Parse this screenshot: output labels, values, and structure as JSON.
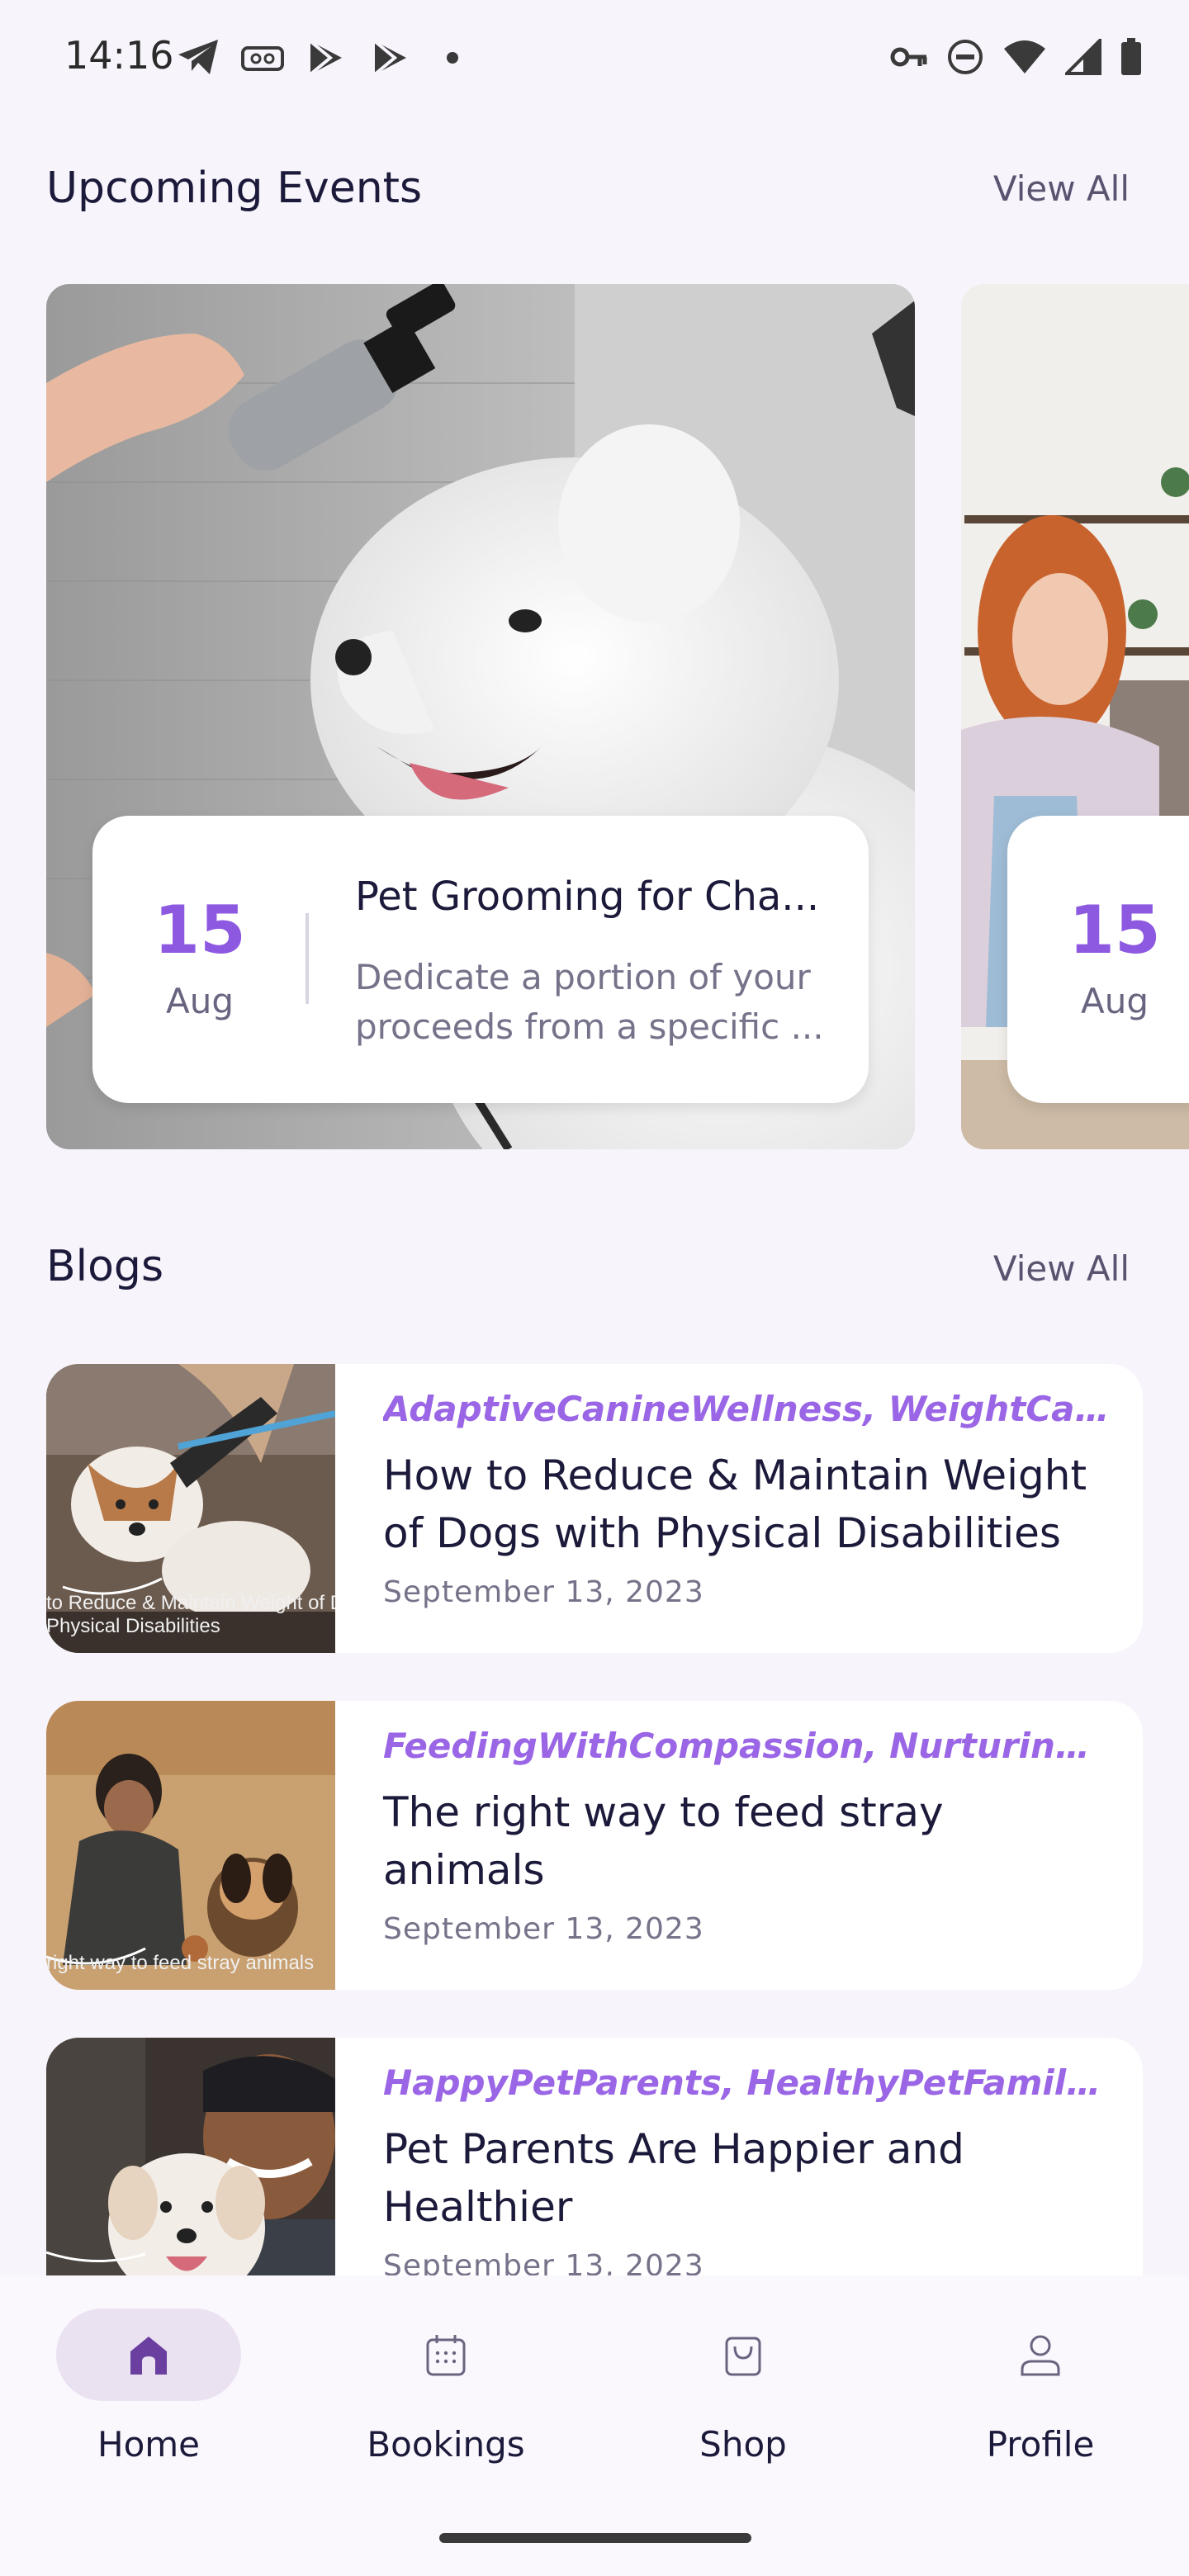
{
  "status_bar": {
    "time": "14:16",
    "left_icons": [
      "telegram-icon",
      "voicemail-icon",
      "play-store-icon",
      "play-store-icon",
      "dot-icon"
    ],
    "right_icons": [
      "vpn-key-icon",
      "dnd-icon",
      "wifi-icon",
      "signal-icon",
      "battery-icon"
    ]
  },
  "events": {
    "title": "Upcoming Events",
    "view_all": "View All",
    "cards": [
      {
        "day": "15",
        "month": "Aug",
        "title": "Pet Grooming for Cha...",
        "desc_line1": "Dedicate a portion of your",
        "desc_line2": "proceeds from a specific ..."
      },
      {
        "day": "15",
        "month": "Aug"
      }
    ]
  },
  "blogs": {
    "title": "Blogs",
    "view_all": "View All",
    "items": [
      {
        "tags": "AdaptiveCanineWellness, WeightCare...",
        "title": "How to Reduce & Maintain Weight of Dogs with Physical Disabilities",
        "date": "September 13, 2023",
        "thumb_caption_1": "to Reduce & Maintain Weight of Do",
        "thumb_caption_2": "Physical Disabilities"
      },
      {
        "tags": "FeedingWithCompassion, NurturingSt...",
        "title": "The right way to feed stray animals",
        "date": "September 13, 2023",
        "thumb_caption_1": "right way to feed stray animals"
      },
      {
        "tags": "HappyPetParents, HealthyPetFamilies",
        "title": "Pet Parents Are Happier and Healthier",
        "date": "September 13, 2023"
      }
    ]
  },
  "nav": {
    "items": [
      {
        "label": "Home",
        "icon": "home-icon",
        "active": true
      },
      {
        "label": "Bookings",
        "icon": "calendar-icon",
        "active": false
      },
      {
        "label": "Shop",
        "icon": "shopping-bag-icon",
        "active": false
      },
      {
        "label": "Profile",
        "icon": "profile-icon",
        "active": false
      }
    ]
  },
  "colors": {
    "accent": "#8d59e0",
    "tag": "#9a66e6",
    "text": "#1c1a3a",
    "muted": "#77728a",
    "background": "#f7f4fb",
    "nav_active_pill": "#eae2f1",
    "nav_icon_active": "#6b3fa0"
  }
}
